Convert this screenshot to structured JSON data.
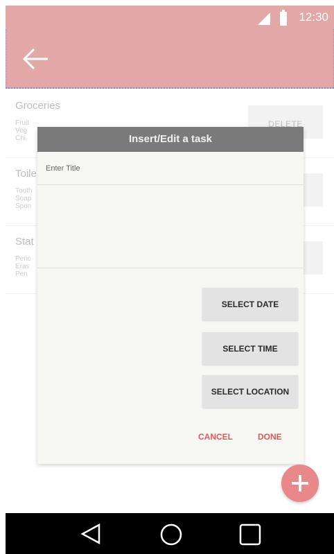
{
  "status_bar": {
    "time": "12:30"
  },
  "app_bar": {
    "back_icon": "arrow-left-icon"
  },
  "list": {
    "items": [
      {
        "title": "Groceries",
        "sub": [
          "Fruit",
          "Veg",
          "Chi"
        ],
        "delete_label": "DELETE"
      },
      {
        "title": "Toile",
        "sub": [
          "Tooth",
          "Soap",
          "Spon"
        ],
        "delete_label": ""
      },
      {
        "title": "Stat",
        "sub": [
          "Penc",
          "Eras",
          "Pen"
        ],
        "delete_label": ""
      }
    ]
  },
  "dialog": {
    "title": "Insert/Edit a task",
    "title_placeholder": "Enter Title",
    "select_date": "SELECT DATE",
    "select_time": "SELECT TIME",
    "select_location": "SELECT LOCATION",
    "cancel": "CANCEL",
    "done": "DONE"
  },
  "fab": {
    "icon": "plus-icon"
  },
  "nav_bar": {
    "back_icon": "triangle-back-icon",
    "home_icon": "circle-home-icon",
    "recents_icon": "square-recents-icon"
  },
  "colors": {
    "primary": "#e2a8a8",
    "accent": "#e05858",
    "fab": "#e8888a"
  }
}
